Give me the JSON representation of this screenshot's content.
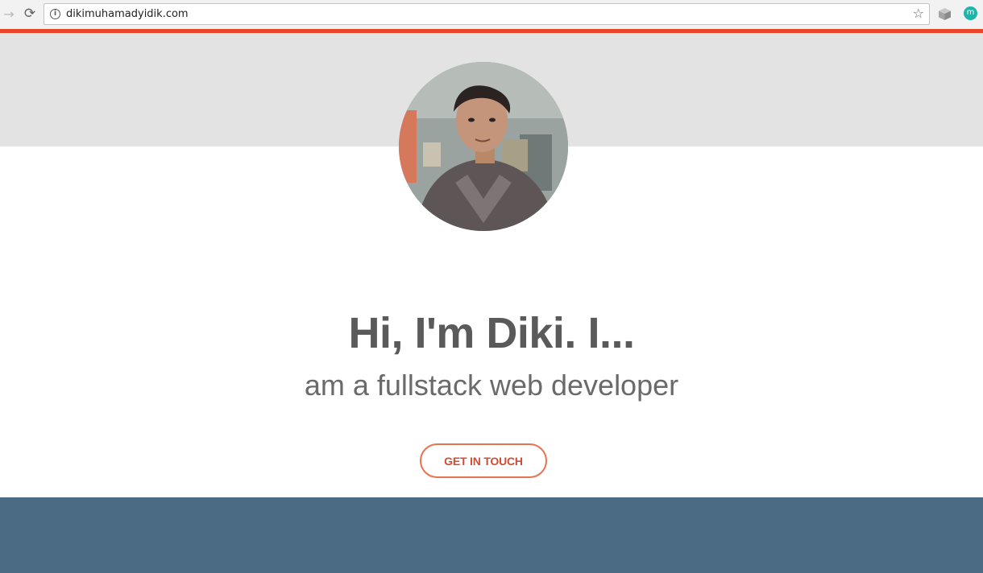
{
  "browser": {
    "url": "dikimuhamadyidik.com",
    "extension_label": "m"
  },
  "hero": {
    "headline": "Hi, I'm Diki. I...",
    "subheadline": "am a fullstack web developer",
    "cta_label": "GET IN TOUCH"
  },
  "colors": {
    "accent": "#e8462a",
    "hero_band": "#e3e3e3",
    "headline": "#5a5a5a",
    "cta_border": "#e8734f",
    "cta_text": "#cf4d33",
    "footer_band": "#4b6b84"
  },
  "icons": {
    "forward": "arrow-right",
    "reload": "reload",
    "info": "info-circle",
    "bookmark": "star",
    "extension": "cube"
  }
}
